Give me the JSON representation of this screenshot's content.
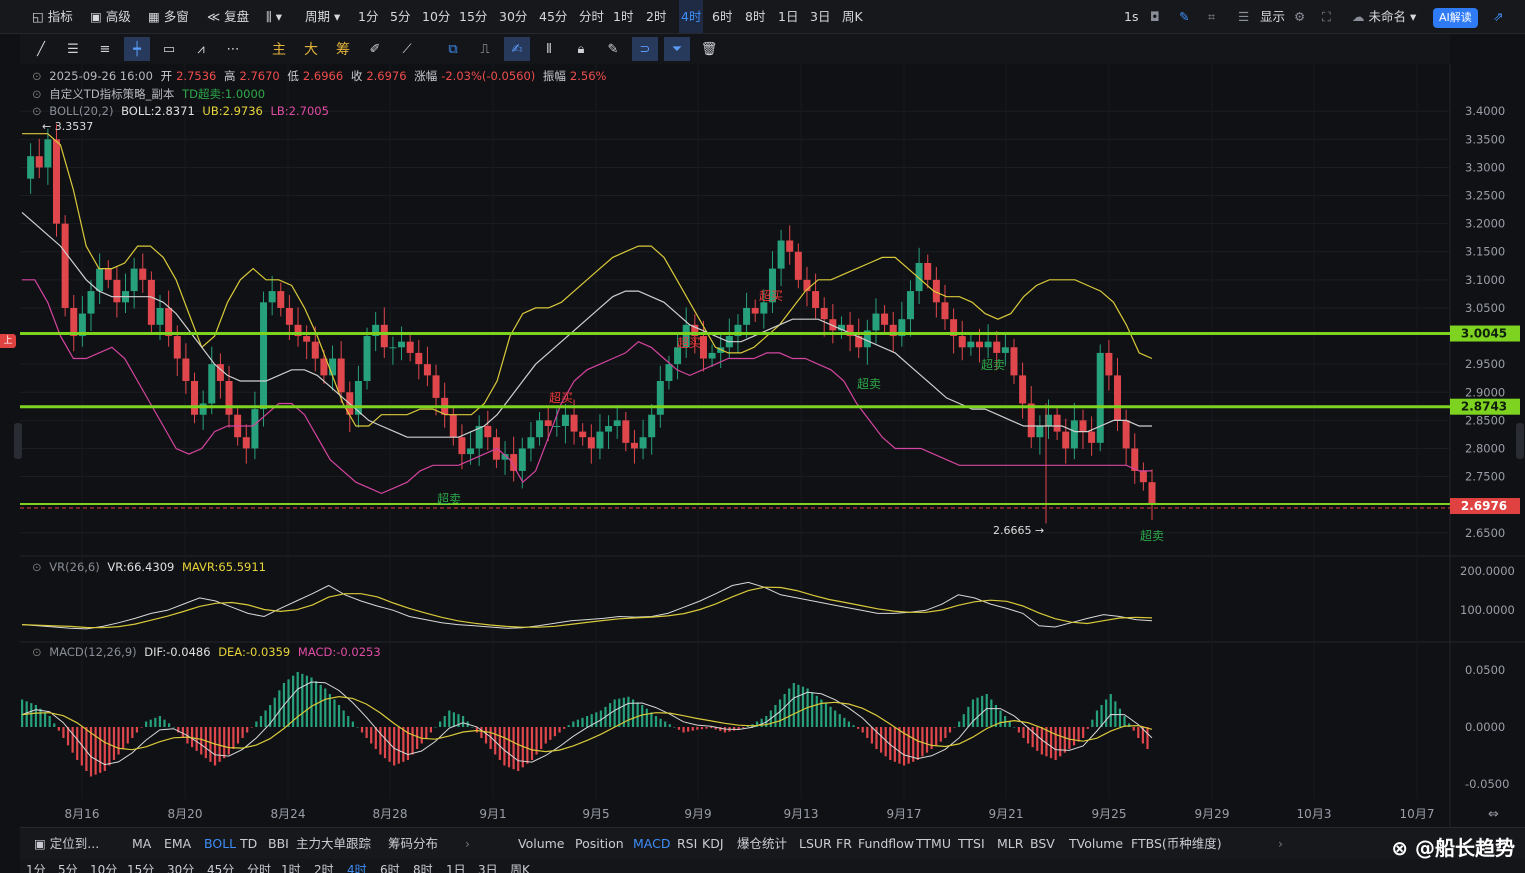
{
  "topbar": {
    "left_items": [
      {
        "label": "指标",
        "icon": "indicator-icon"
      },
      {
        "label": "高级",
        "icon": "calendar-icon"
      },
      {
        "label": "多窗",
        "icon": "grid-icon"
      },
      {
        "label": "复盘",
        "icon": "rewind-icon"
      }
    ],
    "chart_type_icon": "candle-icon",
    "period_label": "周期",
    "intervals": [
      "1分",
      "5分",
      "10分",
      "15分",
      "30分",
      "45分",
      "分时",
      "1时",
      "2时",
      "4时",
      "6时",
      "8时",
      "1日",
      "3日",
      "周K"
    ],
    "selected_interval": "4时",
    "right_items": {
      "refresh": "1s",
      "display": "显示",
      "layout_name": "未命名",
      "ai": "AI解读"
    }
  },
  "legend": {
    "ohlc": {
      "date": "2025-09-26 16:00",
      "open_label": "开",
      "open": "2.7536",
      "high_label": "高",
      "high": "2.7670",
      "low_label": "低",
      "low": "2.6966",
      "close_label": "收",
      "close": "2.6976",
      "change_label": "涨幅",
      "change": "-2.03%(-0.0560)",
      "amp_label": "振幅",
      "amp": "2.56%"
    },
    "strategy": {
      "name": "自定义TD指标策略_副本",
      "signal": "TD超卖:1.0000"
    },
    "boll": {
      "name": "BOLL(20,2)",
      "mid": "BOLL:2.8371",
      "ub": "UB:2.9736",
      "lb": "LB:2.7005"
    },
    "vr": {
      "name": "VR(26,6)",
      "vr": "VR:66.4309",
      "mavr": "MAVR:65.5911"
    },
    "macd": {
      "name": "MACD(12,26,9)",
      "dif": "DIF:-0.0486",
      "dea": "DEA:-0.0359",
      "macd": "MACD:-0.0253"
    }
  },
  "annotations": {
    "high_marker": "← 3.3537",
    "low_marker": "2.6665 →",
    "signals": [
      {
        "text": "超卖",
        "type": "sell"
      },
      {
        "text": "超买",
        "type": "buy"
      },
      {
        "text": "超买",
        "type": "buy"
      },
      {
        "text": "超买",
        "type": "buy"
      },
      {
        "text": "超卖",
        "type": "sell"
      },
      {
        "text": "超卖",
        "type": "sell"
      },
      {
        "text": "超卖",
        "type": "sell"
      }
    ]
  },
  "side_tag": "上",
  "chart_data": {
    "type": "candlestick",
    "price_axis": {
      "ticks": [
        "3.4000",
        "3.3500",
        "3.3000",
        "3.2500",
        "3.2000",
        "3.1500",
        "3.1000",
        "3.0500",
        "2.9500",
        "2.9000",
        "2.8500",
        "2.8000",
        "2.7500",
        "2.6500"
      ],
      "range": [
        2.63,
        3.42
      ]
    },
    "horizontal_lines": [
      {
        "value": 3.0045,
        "label": "3.0045",
        "color": "#7ed321"
      },
      {
        "value": 2.8743,
        "label": "2.8743",
        "color": "#7ed321"
      },
      {
        "value": 2.6976,
        "label": "2.6976",
        "color": "#e04141"
      }
    ],
    "vr_axis": {
      "ticks": [
        "200.0000",
        "100.0000"
      ]
    },
    "macd_axis": {
      "ticks": [
        "0.0500",
        "0.0000",
        "-0.0500"
      ]
    },
    "x_ticks": [
      "8月16",
      "8月20",
      "8月24",
      "8月28",
      "9月1",
      "9月5",
      "9月9",
      "9月13",
      "9月17",
      "9月21",
      "9月25",
      "9月29",
      "10月3",
      "10月7"
    ],
    "close_series": [
      3.28,
      3.32,
      3.3,
      3.35,
      3.2,
      3.05,
      3.0,
      3.04,
      3.08,
      3.12,
      3.1,
      3.06,
      3.08,
      3.12,
      3.1,
      3.02,
      3.05,
      3.0,
      2.96,
      2.92,
      2.86,
      2.88,
      2.95,
      2.92,
      2.86,
      2.82,
      2.8,
      2.87,
      3.06,
      3.08,
      3.05,
      3.02,
      3.0,
      2.99,
      2.96,
      2.93,
      2.96,
      2.9,
      2.86,
      2.92,
      3.0,
      3.02,
      2.98,
      2.98,
      2.99,
      2.97,
      2.95,
      2.93,
      2.89,
      2.86,
      2.82,
      2.79,
      2.8,
      2.84,
      2.82,
      2.78,
      2.79,
      2.76,
      2.8,
      2.82,
      2.85,
      2.84,
      2.84,
      2.86,
      2.83,
      2.82,
      2.8,
      2.83,
      2.84,
      2.85,
      2.81,
      2.8,
      2.82,
      2.86,
      2.92,
      2.95,
      2.98,
      3.02,
      3.0,
      2.96,
      2.97,
      2.98,
      3.0,
      3.02,
      3.05,
      3.04,
      3.06,
      3.12,
      3.17,
      3.15,
      3.1,
      3.08,
      3.05,
      3.03,
      3.01,
      3.02,
      3.0,
      2.98,
      3.01,
      3.04,
      3.02,
      3.0,
      3.03,
      3.08,
      3.13,
      3.1,
      3.06,
      3.03,
      3.0,
      2.98,
      2.99,
      2.98,
      2.99,
      2.97,
      2.98,
      2.93,
      2.88,
      2.82,
      2.84,
      2.86,
      2.83,
      2.8,
      2.85,
      2.83,
      2.81,
      2.97,
      2.93,
      2.85,
      2.8,
      2.76,
      2.74,
      2.7
    ],
    "boll_ub": [
      3.36,
      3.36,
      3.36,
      3.34,
      3.26,
      3.16,
      3.12,
      3.12,
      3.13,
      3.16,
      3.16,
      3.14,
      3.1,
      3.04,
      2.98,
      3.0,
      3.06,
      3.1,
      3.12,
      3.1,
      3.1,
      3.09,
      3.05,
      3.0,
      2.94,
      2.88,
      2.84,
      2.84,
      2.86,
      2.86,
      2.86,
      2.87,
      2.87,
      2.86,
      2.86,
      2.86,
      2.88,
      2.92,
      3.0,
      3.04,
      3.05,
      3.05,
      3.06,
      3.08,
      3.1,
      3.12,
      3.14,
      3.15,
      3.16,
      3.16,
      3.14,
      3.1,
      3.06,
      3.02,
      2.98,
      2.97,
      2.97,
      2.98,
      3.0,
      3.02,
      3.05,
      3.08,
      3.1,
      3.1,
      3.11,
      3.12,
      3.13,
      3.14,
      3.14,
      3.12,
      3.1,
      3.08,
      3.07,
      3.07,
      3.06,
      3.04,
      3.03,
      3.04,
      3.07,
      3.09,
      3.1,
      3.1,
      3.1,
      3.09,
      3.08,
      3.06,
      3.02,
      2.97,
      2.96
    ],
    "boll_mid": [
      3.22,
      3.2,
      3.18,
      3.16,
      3.13,
      3.1,
      3.08,
      3.07,
      3.07,
      3.07,
      3.07,
      3.06,
      3.04,
      3.01,
      2.98,
      2.95,
      2.93,
      2.92,
      2.92,
      2.92,
      2.93,
      2.94,
      2.94,
      2.93,
      2.91,
      2.89,
      2.87,
      2.85,
      2.84,
      2.83,
      2.82,
      2.82,
      2.82,
      2.82,
      2.82,
      2.83,
      2.84,
      2.86,
      2.89,
      2.92,
      2.95,
      2.97,
      2.99,
      3.01,
      3.03,
      3.05,
      3.07,
      3.08,
      3.08,
      3.07,
      3.06,
      3.04,
      3.02,
      3.01,
      3.0,
      2.99,
      2.99,
      3.0,
      3.01,
      3.02,
      3.03,
      3.03,
      3.03,
      3.02,
      3.01,
      3.0,
      2.99,
      2.98,
      2.97,
      2.95,
      2.93,
      2.91,
      2.89,
      2.88,
      2.87,
      2.87,
      2.86,
      2.85,
      2.84,
      2.84,
      2.84,
      2.84,
      2.83,
      2.83,
      2.84,
      2.85,
      2.85,
      2.84,
      2.84
    ],
    "boll_lb": [
      3.1,
      3.1,
      3.06,
      3.0,
      2.96,
      2.96,
      2.97,
      2.98,
      2.96,
      2.92,
      2.88,
      2.84,
      2.8,
      2.79,
      2.8,
      2.83,
      2.84,
      2.84,
      2.84,
      2.86,
      2.88,
      2.88,
      2.86,
      2.82,
      2.78,
      2.76,
      2.74,
      2.73,
      2.72,
      2.73,
      2.74,
      2.76,
      2.77,
      2.77,
      2.77,
      2.78,
      2.79,
      2.8,
      2.78,
      2.74,
      2.76,
      2.82,
      2.88,
      2.92,
      2.94,
      2.95,
      2.96,
      2.97,
      2.99,
      2.98,
      2.96,
      2.94,
      2.93,
      2.94,
      2.95,
      2.96,
      2.96,
      2.96,
      2.97,
      2.97,
      2.96,
      2.96,
      2.95,
      2.94,
      2.92,
      2.88,
      2.85,
      2.82,
      2.8,
      2.8,
      2.8,
      2.79,
      2.78,
      2.77,
      2.77,
      2.77,
      2.77,
      2.77,
      2.77,
      2.77,
      2.77,
      2.77,
      2.77,
      2.77,
      2.77,
      2.77,
      2.77,
      2.76,
      2.76
    ],
    "vr_series": [
      0.12,
      0.1,
      0.08,
      0.06,
      0.05,
      0.09,
      0.15,
      0.22,
      0.3,
      0.35,
      0.45,
      0.55,
      0.5,
      0.4,
      0.3,
      0.25,
      0.38,
      0.5,
      0.62,
      0.75,
      0.6,
      0.5,
      0.42,
      0.35,
      0.25,
      0.2,
      0.15,
      0.12,
      0.1,
      0.08,
      0.06,
      0.07,
      0.1,
      0.14,
      0.18,
      0.2,
      0.22,
      0.25,
      0.24,
      0.25,
      0.3,
      0.4,
      0.5,
      0.62,
      0.75,
      0.8,
      0.72,
      0.6,
      0.55,
      0.5,
      0.45,
      0.4,
      0.35,
      0.3,
      0.3,
      0.32,
      0.35,
      0.45,
      0.6,
      0.55,
      0.45,
      0.38,
      0.3,
      0.1,
      0.08,
      0.15,
      0.22,
      0.28,
      0.25,
      0.2,
      0.18
    ],
    "macd_hist": [
      0.5,
      0.4,
      0.2,
      -0.2,
      -0.6,
      -0.9,
      -0.8,
      -0.5,
      -0.2,
      0.1,
      0.2,
      0.0,
      -0.3,
      -0.5,
      -0.7,
      -0.5,
      -0.2,
      0.1,
      0.4,
      0.8,
      1.0,
      0.9,
      0.7,
      0.4,
      0.1,
      -0.2,
      -0.5,
      -0.7,
      -0.6,
      -0.3,
      0.0,
      0.3,
      0.2,
      -0.1,
      -0.4,
      -0.7,
      -0.8,
      -0.6,
      -0.3,
      -0.1,
      0.1,
      0.2,
      0.3,
      0.5,
      0.55,
      0.4,
      0.2,
      0.05,
      -0.1,
      -0.05,
      -0.02,
      -0.1,
      -0.05,
      0.05,
      0.2,
      0.5,
      0.8,
      0.7,
      0.5,
      0.3,
      0.1,
      -0.1,
      -0.4,
      -0.6,
      -0.7,
      -0.6,
      -0.4,
      -0.2,
      0.1,
      0.5,
      0.6,
      0.3,
      0.0,
      -0.3,
      -0.5,
      -0.6,
      -0.4,
      -0.2,
      0.3,
      0.6,
      0.2,
      -0.2,
      -0.5
    ]
  }
}
